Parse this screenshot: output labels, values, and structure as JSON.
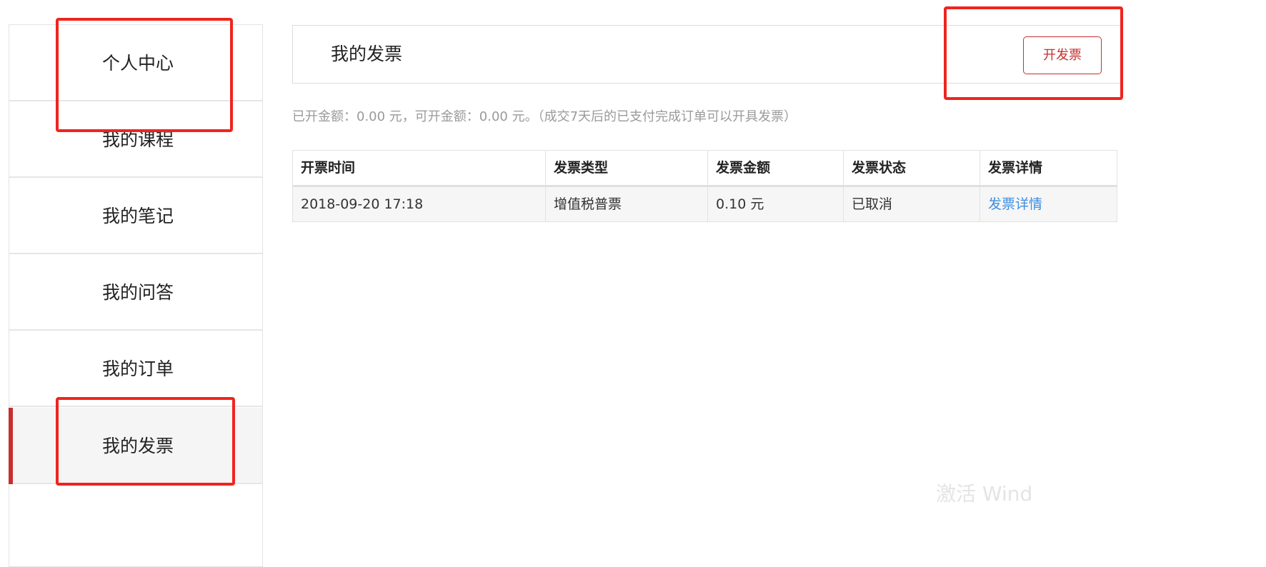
{
  "sidebar": {
    "items": [
      {
        "label": "个人中心",
        "active": false
      },
      {
        "label": "我的课程",
        "active": false
      },
      {
        "label": "我的笔记",
        "active": false
      },
      {
        "label": "我的问答",
        "active": false
      },
      {
        "label": "我的订单",
        "active": false
      },
      {
        "label": "我的发票",
        "active": true
      }
    ]
  },
  "header": {
    "title": "我的发票",
    "button_label": "开发票"
  },
  "summary": {
    "text": "已开金额：0.00 元，可开金额：0.00 元。（成交7天后的已支付完成订单可以开具发票）"
  },
  "table": {
    "columns": [
      "开票时间",
      "发票类型",
      "发票金额",
      "发票状态",
      "发票详情"
    ],
    "rows": [
      {
        "time": "2018-09-20 17:18",
        "type": "增值税普票",
        "amount": "0.10 元",
        "status": "已取消",
        "detail_link": "发票详情"
      }
    ]
  },
  "watermark": {
    "text": "激活 Wind"
  },
  "colors": {
    "accent": "#c62f2f",
    "link": "#3d8fe0",
    "annotation": "#f0241e"
  }
}
